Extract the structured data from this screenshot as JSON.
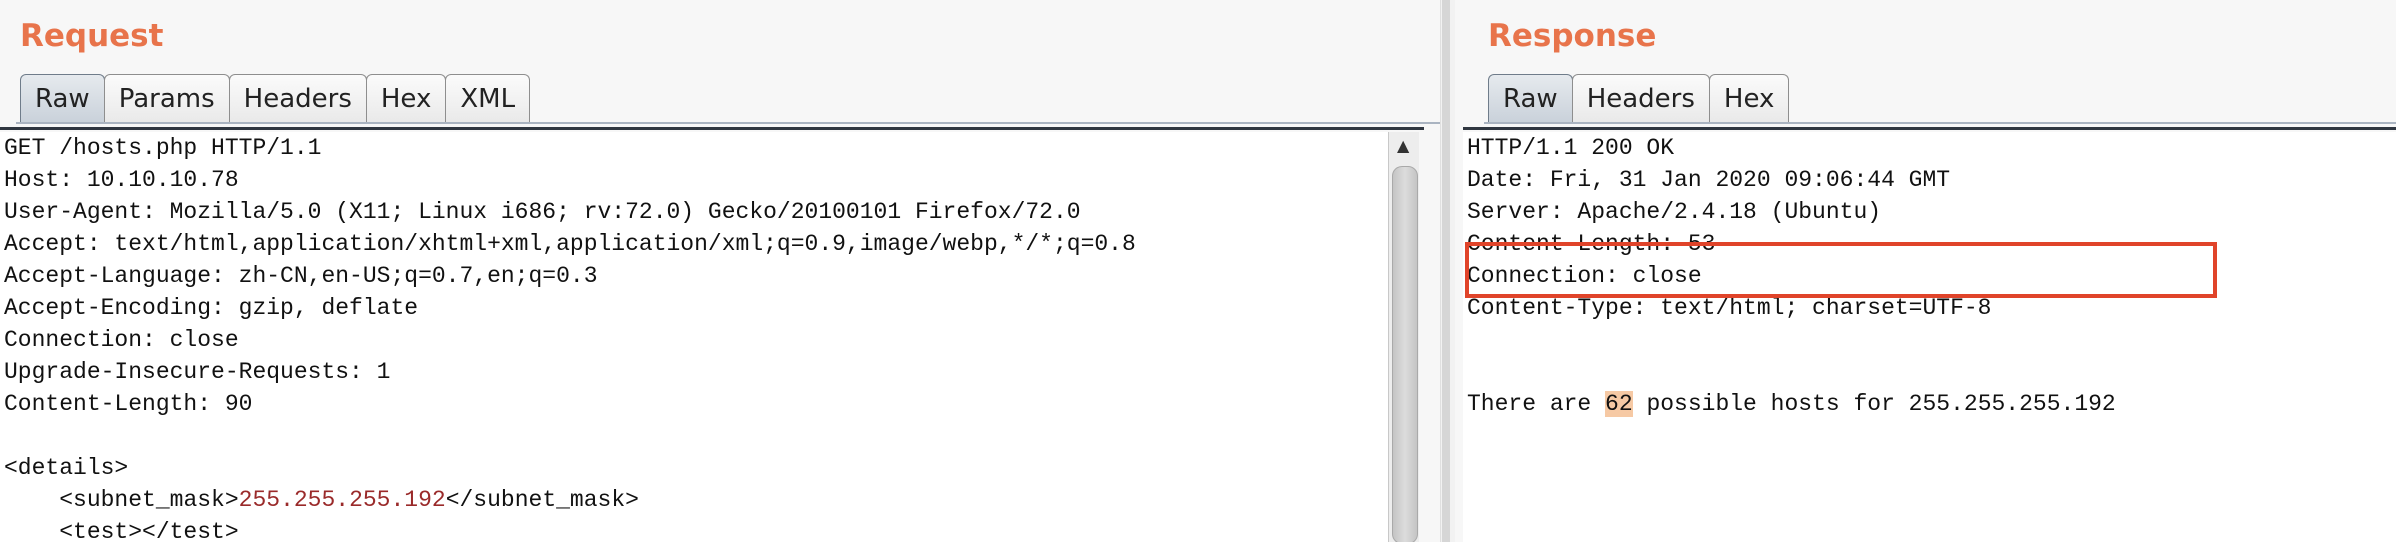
{
  "request": {
    "title": "Request",
    "tabs": [
      "Raw",
      "Params",
      "Headers",
      "Hex",
      "XML"
    ],
    "active_tab": "Raw",
    "lines": [
      "GET /hosts.php HTTP/1.1",
      "Host: 10.10.10.78",
      "User-Agent: Mozilla/5.0 (X11; Linux i686; rv:72.0) Gecko/20100101 Firefox/72.0",
      "Accept: text/html,application/xhtml+xml,application/xml;q=0.9,image/webp,*/*;q=0.8",
      "Accept-Language: zh-CN,en-US;q=0.7,en;q=0.3",
      "Accept-Encoding: gzip, deflate",
      "Connection: close",
      "Upgrade-Insecure-Requests: 1",
      "Content-Length: 90",
      "",
      "<details>"
    ],
    "xml_line1": {
      "indent": "    ",
      "open": "<subnet_mask>",
      "value": "255.255.255.192",
      "close": "</subnet_mask>"
    },
    "xml_line2": "    <test></test>"
  },
  "response": {
    "title": "Response",
    "tabs": [
      "Raw",
      "Headers",
      "Hex"
    ],
    "active_tab": "Raw",
    "lines": [
      "HTTP/1.1 200 OK",
      "Date: Fri, 31 Jan 2020 09:06:44 GMT",
      "Server: Apache/2.4.18 (Ubuntu)",
      "Content-Length: 53",
      "Connection: close",
      "Content-Type: text/html; charset=UTF-8",
      "",
      ""
    ],
    "body": {
      "prefix": "There are ",
      "count": "62",
      "suffix": " possible hosts for 255.255.255.192"
    }
  },
  "colors": {
    "title": "#e8744b",
    "highlight_border": "#e0442a",
    "number_highlight": "#f6c9a4",
    "xml_value": "#9a2a2a"
  },
  "icons": {
    "scroll_up": "triangle-up"
  }
}
